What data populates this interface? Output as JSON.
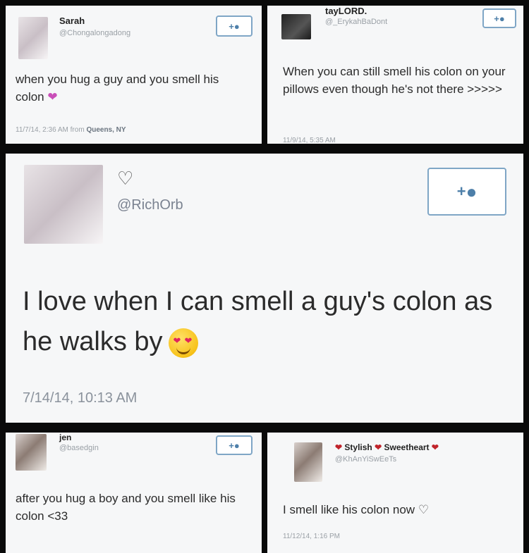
{
  "tweet1": {
    "name": "Sarah",
    "handle": "@Chongalongadong",
    "text": "when you hug a guy and you smell his colon",
    "emoji": "❤",
    "timestamp": "11/7/14, 2:36 AM from",
    "location": "Queens, NY",
    "follow_plus": "+"
  },
  "tweet2": {
    "name": "tayLORD.",
    "handle": "@_ErykahBaDont",
    "text": "When you can still smell his colon on your pillows even though he's not there >>>>>",
    "timestamp": "11/9/14, 5:35 AM",
    "follow_plus": "+"
  },
  "tweet3": {
    "handle": "@RichOrb",
    "heart": "♡",
    "text": "I love when I can smell a guy's colon as he walks by",
    "timestamp": "7/14/14, 10:13 AM",
    "follow_plus": "+"
  },
  "tweet4": {
    "name": "jen",
    "handle": "@basedgin",
    "text": "after you hug a boy and you smell like his colon <33",
    "follow_plus": "+"
  },
  "tweet5": {
    "name_part1": "Stylish",
    "name_part2": "Sweetheart",
    "heart": "❤",
    "handle": "@KhAnYiSwEeTs",
    "text": "I smell like his colon now",
    "text_heart": "♡",
    "timestamp": "11/12/14, 1:16 PM"
  }
}
